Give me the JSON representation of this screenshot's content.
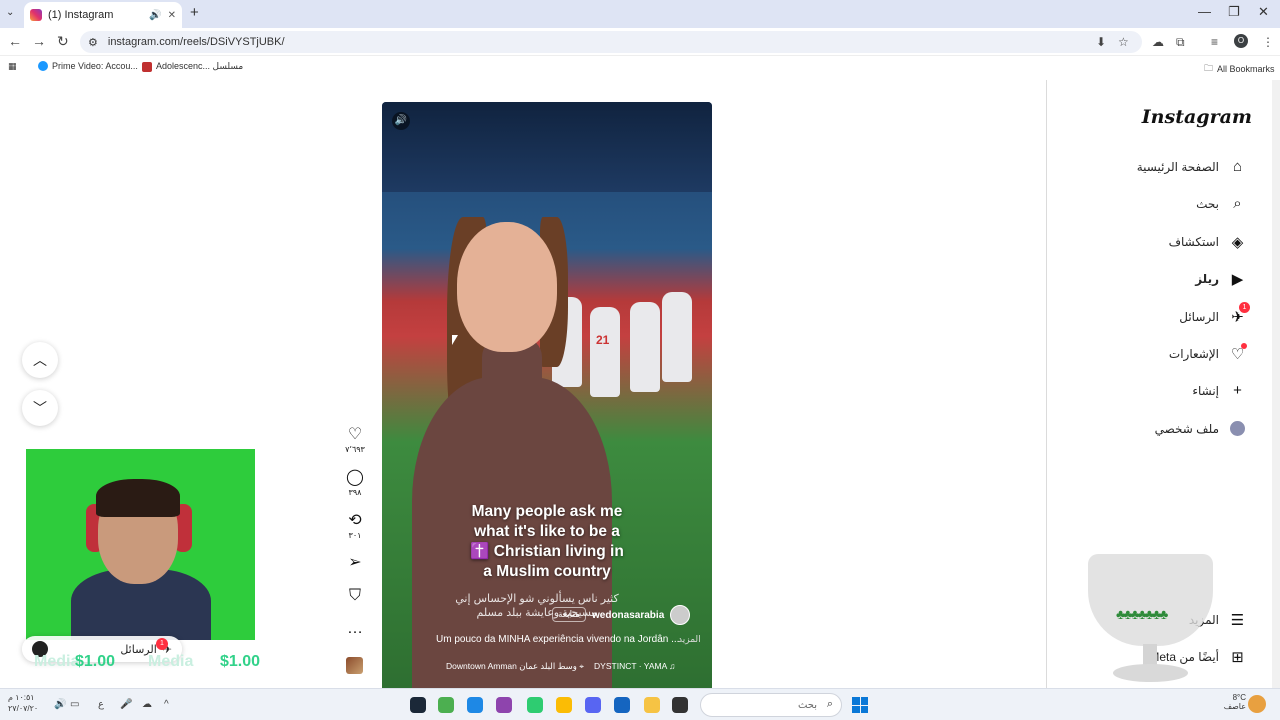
{
  "browser": {
    "tab_title": "(1) Instagram",
    "tab_sound_icon": "speaker-icon",
    "url": "instagram.com/reels/DSiVYSTjUBK/",
    "bookmarks": [
      "Prime Video: Accou...",
      "Adolescenc... مسلسل"
    ],
    "all_bookmarks": "All Bookmarks",
    "profile_initial": "O"
  },
  "sidebar": {
    "logo": "Instagram",
    "items": [
      {
        "label": "الصفحة الرئيسية",
        "icon": "home-icon"
      },
      {
        "label": "بحث",
        "icon": "search-icon"
      },
      {
        "label": "استكشاف",
        "icon": "compass-icon"
      },
      {
        "label": "ريلز",
        "icon": "reels-icon"
      },
      {
        "label": "الرسائل",
        "icon": "messenger-icon",
        "badge": "1"
      },
      {
        "label": "الإشعارات",
        "icon": "heart-icon"
      },
      {
        "label": "إنشاء",
        "icon": "plus-icon"
      },
      {
        "label": "ملف شخصي",
        "icon": "profile-avatar"
      }
    ],
    "more": "المزيد",
    "meta": "أيضًا من Meta"
  },
  "reel": {
    "caption_lines": [
      "Many people ask me",
      "what it's like to be a",
      "✝️ Christian living in",
      "a Muslim country"
    ],
    "caption_ar": "كثير ناس يسألوني شو الإحساس إني مسيحية وعايشة ببلد مسلم",
    "author": "wedonasarabia",
    "follow": "متابعة",
    "description": "Um pouco da MINHA experiência vivendo na Jordân ...",
    "more": "المزيد",
    "location": "Downtown Amman وسط البلد عمان",
    "audio": "DYSTINCT · YAMA",
    "jersey_number": "21"
  },
  "actions": {
    "likes": "٧٬٦٩٣",
    "comments": "٣٩٨",
    "reposts": "٣٠١"
  },
  "overlay": {
    "messages_label": "الرسائل",
    "messages_badge": "1",
    "price_a": "$1.00",
    "price_b": "$1.00",
    "ghost_a": "Media",
    "ghost_b": "Media"
  },
  "taskbar": {
    "search_placeholder": "بحث",
    "time": "١٠:٥١ م",
    "date": "٢٧/٠٧/٢٠",
    "lang": "ع",
    "temp": "8°C",
    "weather": "عاصف"
  }
}
